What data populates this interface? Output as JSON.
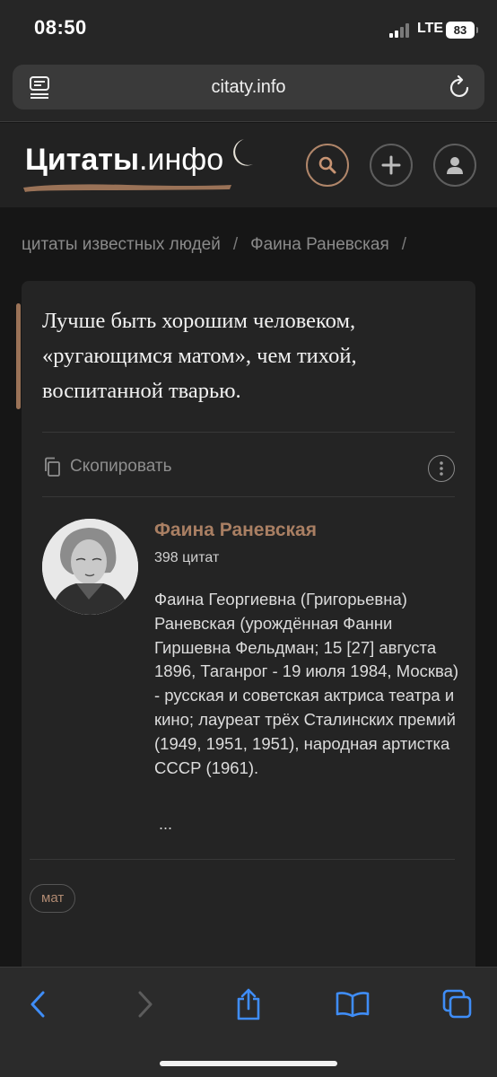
{
  "status_bar": {
    "time": "08:50",
    "network": "LTE",
    "battery": "83"
  },
  "browser": {
    "url": "citaty.info"
  },
  "site": {
    "logo_bold": "Цитаты",
    "logo_regular": ".инфо",
    "accent_color": "#a97f63",
    "header_icons": [
      "search-icon",
      "plus-icon",
      "user-icon"
    ]
  },
  "breadcrumb": {
    "items": [
      "цитаты известных людей",
      "Фаина Раневская"
    ],
    "separator": "/"
  },
  "quote": {
    "text": "Лучше быть хорошим человеком, «ругающимся матом», чем тихой, воспитанной тварью.",
    "copy_label": "Скопировать"
  },
  "author": {
    "name": "Фаина Раневская",
    "count": "398 цитат",
    "bio": "Фаина Георгиевна (Григорьевна) Раневская (урождённая Фанни Гиршевна Фельдман; 15 [27] августа 1896, Таганрог - 19 июля 1984, Москва) - русская и советская актриса театра и кино; лауреат трёх Сталинских премий (1949, 1951, 1951), народная артистка СССР (1961).",
    "more": "..."
  },
  "tags": [
    "мат"
  ],
  "toolbar": {
    "icons": [
      "back-icon",
      "forward-icon",
      "share-icon",
      "bookmarks-icon",
      "tabs-icon"
    ]
  }
}
